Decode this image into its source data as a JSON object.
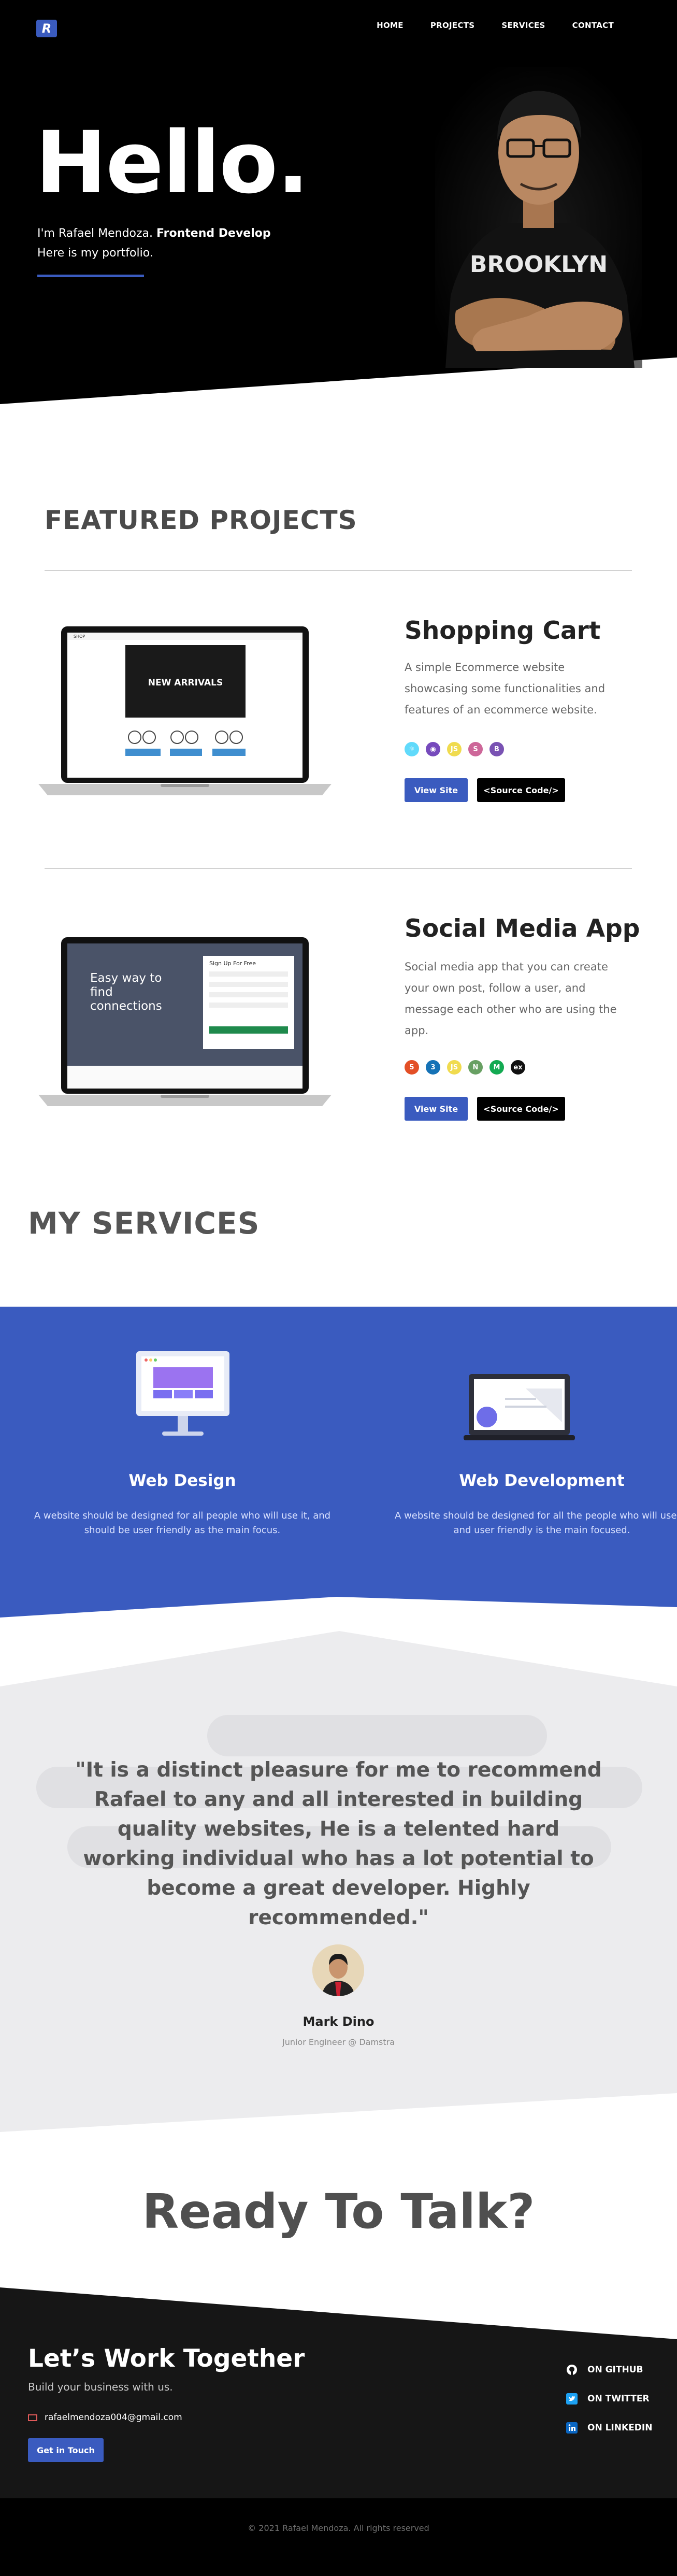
{
  "nav": {
    "logo_letter": "R",
    "links": [
      "HOME",
      "PROJECTS",
      "SERVICES",
      "CONTACT"
    ]
  },
  "hero": {
    "headline": "Hello.",
    "intro_prefix": "I'm Rafael Mendoza. ",
    "intro_role": "Frontend Develop",
    "intro_line2": "Here is my portfolio.",
    "shirt_text": "BROOKLYN"
  },
  "featured": {
    "title": "FEATURED PROJECTS",
    "projects": [
      {
        "title": "Shopping Cart",
        "description": "A simple Ecommerce website showcasing some functionalities and features of an ecommerce website.",
        "view_label": "View Site",
        "source_label": "<Source Code/>",
        "screen_banner": "NEW ARRIVALS",
        "tech_icons": [
          {
            "name": "react-icon",
            "glyph": "⚛",
            "color": "#61dafb"
          },
          {
            "name": "redux-icon",
            "glyph": "◉",
            "color": "#764abc"
          },
          {
            "name": "js-icon",
            "glyph": "JS",
            "color": "#f0db4f"
          },
          {
            "name": "sass-icon",
            "glyph": "S",
            "color": "#cd6799"
          },
          {
            "name": "bootstrap-icon",
            "glyph": "B",
            "color": "#7952b3"
          }
        ]
      },
      {
        "title": "Social Media App",
        "description": "Social media app that you can create your own post, follow a user, and message each other who are using the app.",
        "view_label": "View Site",
        "source_label": "<Source Code/>",
        "screen_headline": "Easy way to find connections",
        "screen_form_title": "Sign Up For Free",
        "tech_icons": [
          {
            "name": "html-icon",
            "glyph": "5",
            "color": "#e34f26"
          },
          {
            "name": "css-icon",
            "glyph": "3",
            "color": "#1572b6"
          },
          {
            "name": "js-icon",
            "glyph": "JS",
            "color": "#f0db4f"
          },
          {
            "name": "node-icon",
            "glyph": "N",
            "color": "#68a063"
          },
          {
            "name": "mongodb-icon",
            "glyph": "M",
            "color": "#13aa52"
          },
          {
            "name": "express-icon",
            "glyph": "ex",
            "color": "#111111"
          }
        ]
      }
    ]
  },
  "services": {
    "title": "MY SERVICES",
    "items": [
      {
        "title": "Web Design",
        "description": "A website should be designed for all people who will use it, and should be user friendly as the main focus."
      },
      {
        "title": "Web Development",
        "description": "A website should be designed for all the people who will use it, and user friendly is the main focused."
      }
    ]
  },
  "testimonial": {
    "quote": "\"It is a distinct pleasure for me to recommend Rafael to any and all interested in building quality websites, He is a telented hard working individual who has a lot potential to become a great developer. Highly recommended.\"",
    "name": "Mark Dino",
    "role": "Junior Engineer @ Damstra"
  },
  "cta": {
    "title": "Ready To Talk?"
  },
  "footer": {
    "title": "Let’s Work Together",
    "subtitle": "Build your business with us.",
    "email": "rafaelmendoza004@gmail.com",
    "button_label": "Get in Touch",
    "socials": [
      {
        "label": "ON GITHUB",
        "icon": "github-icon"
      },
      {
        "label": "ON TWITTER",
        "icon": "twitter-icon"
      },
      {
        "label": "ON LINKEDIN",
        "icon": "linkedin-icon"
      }
    ],
    "copyright": "© 2021 Rafael Mendoza. All rights reserved"
  },
  "colors": {
    "accent": "#3a5bbf",
    "hero_bg": "#000000",
    "services_bg": "#3a5bbf",
    "testimonial_bg": "#ececee",
    "footer_bg": "#161616"
  }
}
